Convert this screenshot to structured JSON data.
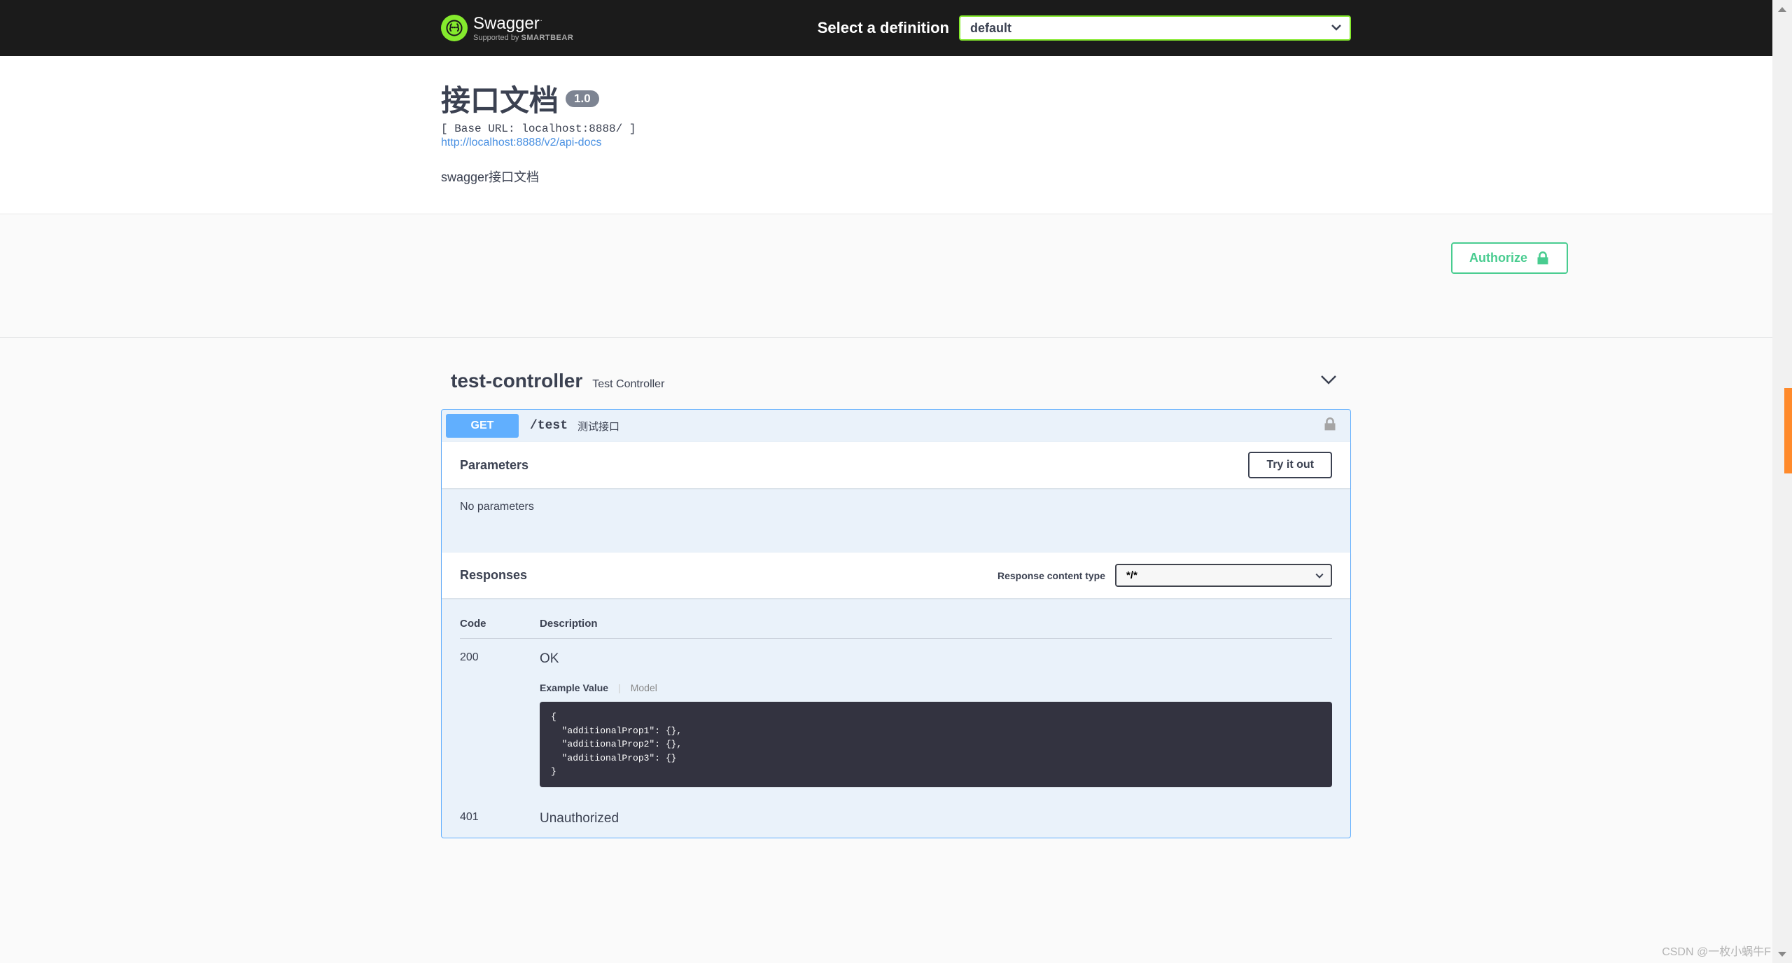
{
  "topbar": {
    "logo_main": "Swagger",
    "logo_sub_prefix": "Supported by ",
    "logo_sub_brand": "SMARTBEAR",
    "def_label": "Select a definition",
    "def_selected": "default"
  },
  "info": {
    "title": "接口文档",
    "version": "1.0",
    "base_url": "[ Base URL: localhost:8888/ ]",
    "api_docs_url": "http://localhost:8888/v2/api-docs",
    "description": "swagger接口文档"
  },
  "authorize_label": "Authorize",
  "tag": {
    "name": "test-controller",
    "description": "Test Controller"
  },
  "operation": {
    "method": "GET",
    "path": "/test",
    "summary": "测试接口",
    "parameters_title": "Parameters",
    "try_label": "Try it out",
    "no_params": "No parameters",
    "responses_title": "Responses",
    "response_ct_label": "Response content type",
    "response_ct_selected": "*/*",
    "table": {
      "code_header": "Code",
      "desc_header": "Description"
    },
    "responses": [
      {
        "code": "200",
        "description": "OK",
        "tab_example": "Example Value",
        "tab_model": "Model",
        "example": "{\n  \"additionalProp1\": {},\n  \"additionalProp2\": {},\n  \"additionalProp3\": {}\n}"
      },
      {
        "code": "401",
        "description": "Unauthorized"
      }
    ]
  },
  "watermark": "CSDN @一枚小蜗牛F"
}
